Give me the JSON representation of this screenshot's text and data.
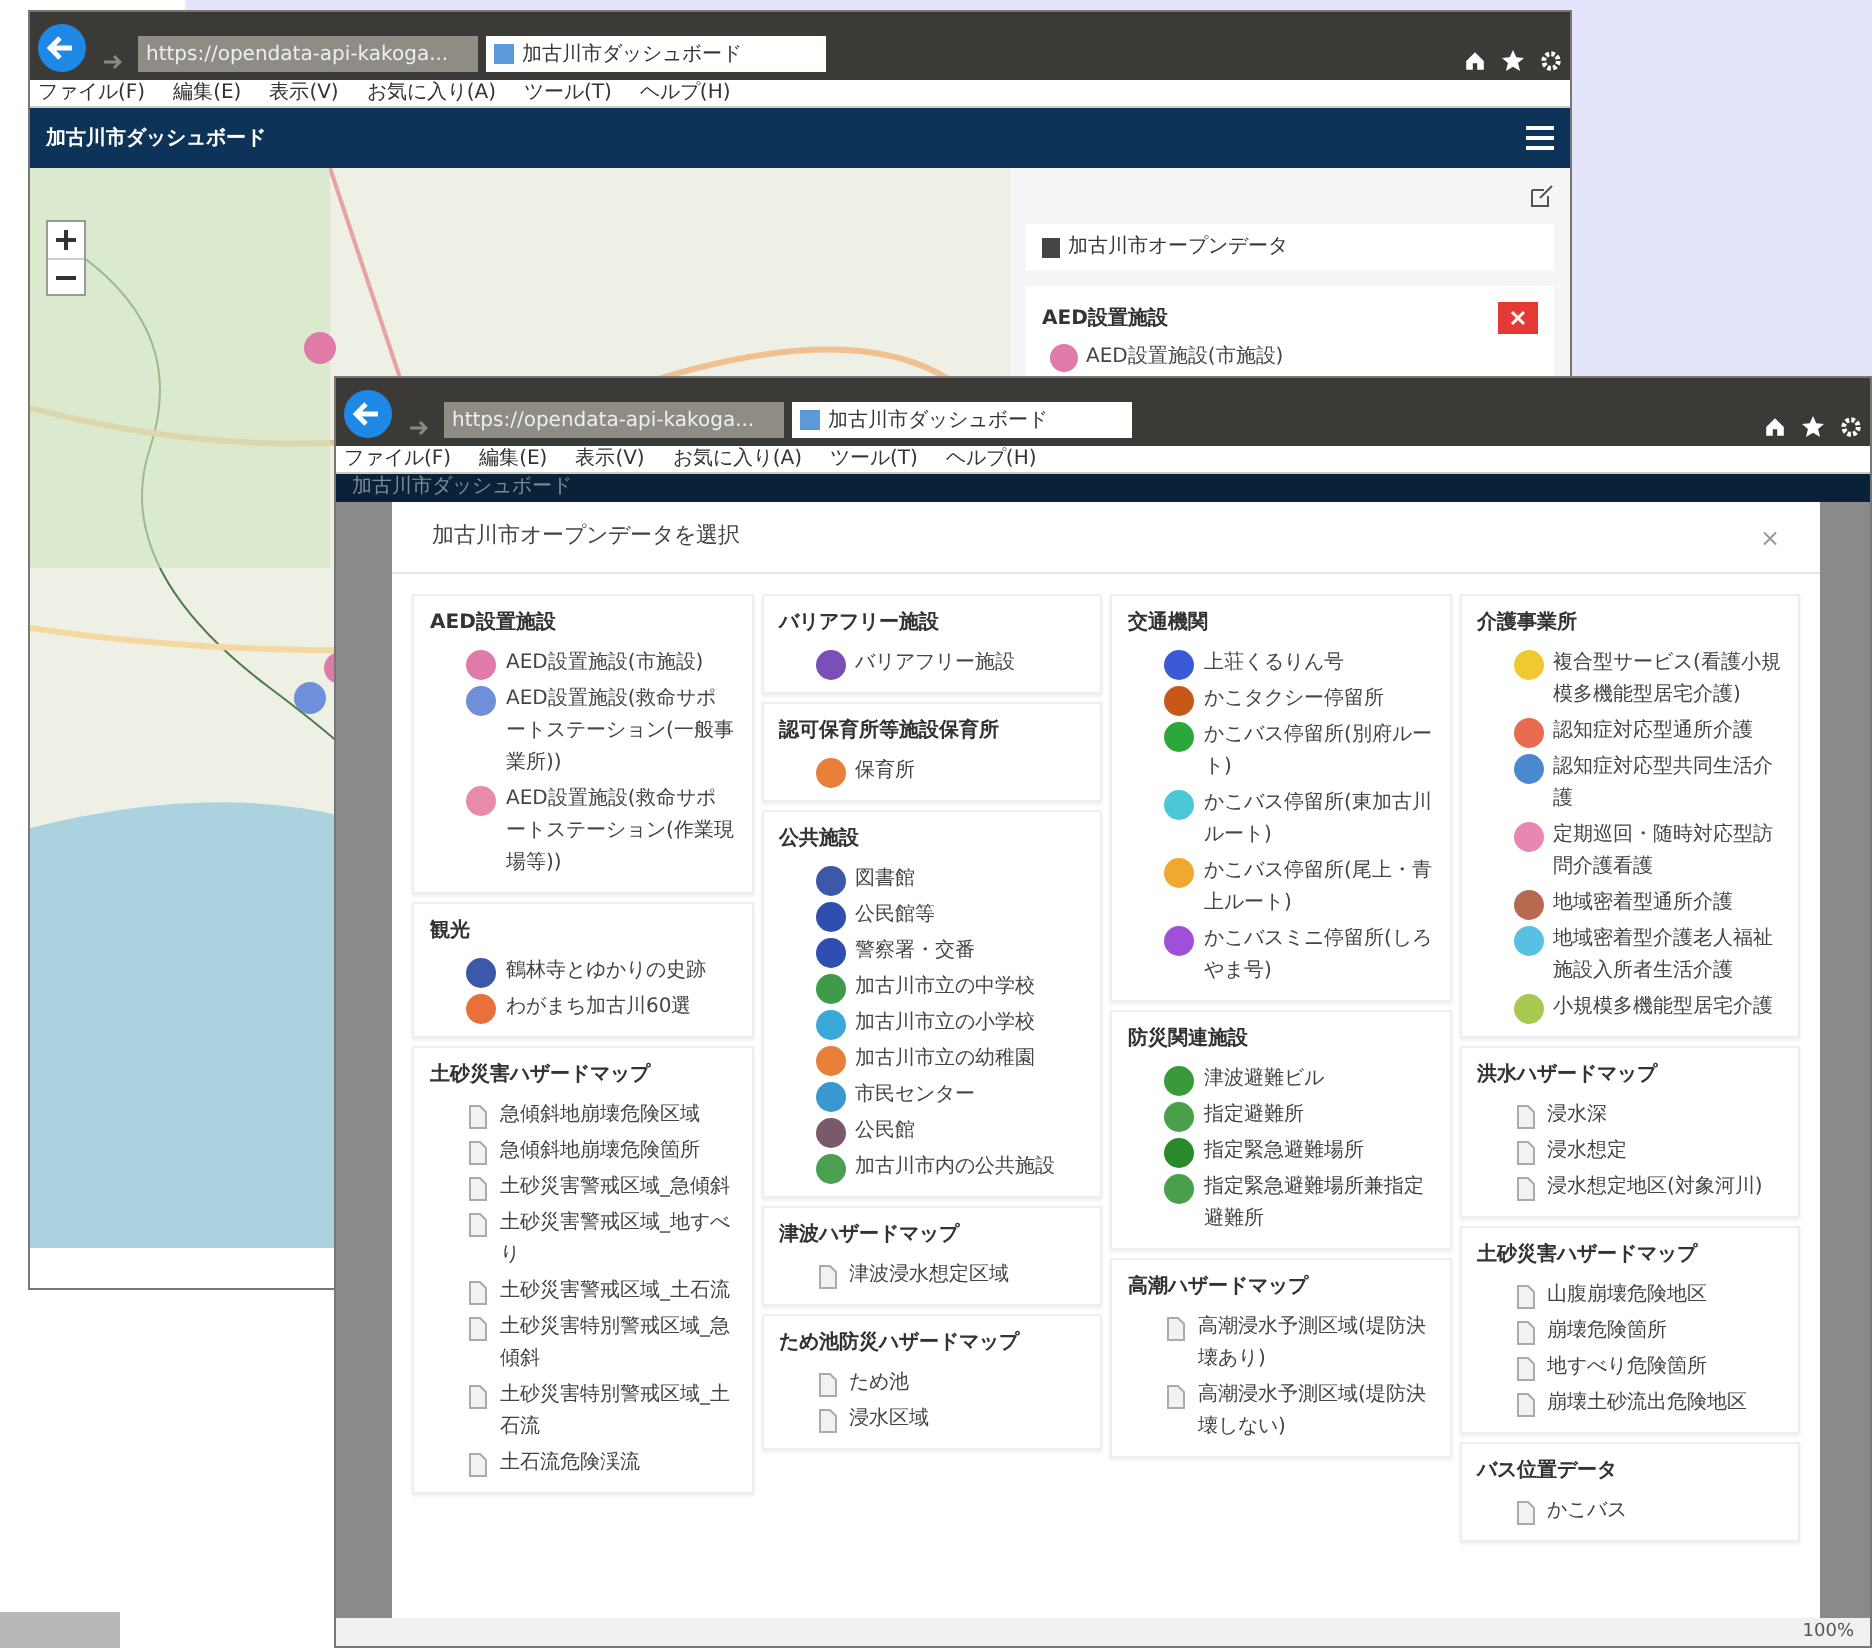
{
  "back_window": {
    "address": "https://opendata-api-kakoga...",
    "tab_title": "加古川市ダッシュボード",
    "menu": [
      "ファイル(F)",
      "編集(E)",
      "表示(V)",
      "お気に入り(A)",
      "ツール(T)",
      "ヘルプ(H)"
    ],
    "app_title": "加古川市ダッシュボード",
    "panel_title": "加古川市オープンデータ",
    "card_title": "AED設置施設",
    "card_items": [
      {
        "label": "AED設置施設(市施設)",
        "color": "#e07aa8"
      }
    ]
  },
  "front_window": {
    "address": "https://opendata-api-kakoga...",
    "tab_title": "加古川市ダッシュボード",
    "menu": [
      "ファイル(F)",
      "編集(E)",
      "表示(V)",
      "お気に入り(A)",
      "ツール(T)",
      "ヘルプ(H)"
    ],
    "app_title": "加古川市ダッシュボード",
    "zoom": "100%",
    "modal": {
      "title": "加古川市オープンデータを選択",
      "close": "×",
      "columns": [
        {
          "sections": [
            {
              "title": "AED設置施設",
              "items": [
                {
                  "kind": "point",
                  "label": "AED設置施設(市施設)",
                  "color": "#e07aa8"
                },
                {
                  "kind": "point",
                  "label": "AED設置施設(救命サポートステーション(一般事業所))",
                  "color": "#6f8fd8"
                },
                {
                  "kind": "point",
                  "label": "AED設置施設(救命サポートステーション(作業現場等))",
                  "color": "#e88aa8"
                }
              ]
            },
            {
              "title": "観光",
              "items": [
                {
                  "kind": "point",
                  "label": "鶴林寺とゆかりの史跡",
                  "color": "#3c58a8"
                },
                {
                  "kind": "point",
                  "label": "わがまち加古川60選",
                  "color": "#e8703a"
                }
              ]
            },
            {
              "title": "土砂災害ハザードマップ",
              "items": [
                {
                  "kind": "layer",
                  "label": "急傾斜地崩壊危険区域"
                },
                {
                  "kind": "layer",
                  "label": "急傾斜地崩壊危険箇所"
                },
                {
                  "kind": "layer",
                  "label": "土砂災害警戒区域_急傾斜"
                },
                {
                  "kind": "layer",
                  "label": "土砂災害警戒区域_地すべり"
                },
                {
                  "kind": "layer",
                  "label": "土砂災害警戒区域_土石流"
                },
                {
                  "kind": "layer",
                  "label": "土砂災害特別警戒区域_急傾斜"
                },
                {
                  "kind": "layer",
                  "label": "土砂災害特別警戒区域_土石流"
                },
                {
                  "kind": "layer",
                  "label": "土石流危険渓流"
                }
              ]
            }
          ]
        },
        {
          "sections": [
            {
              "title": "バリアフリー施設",
              "items": [
                {
                  "kind": "point",
                  "label": "バリアフリー施設",
                  "color": "#7a4fb8"
                }
              ]
            },
            {
              "title": "認可保育所等施設保育所",
              "items": [
                {
                  "kind": "point",
                  "label": "保育所",
                  "color": "#e8803a"
                }
              ]
            },
            {
              "title": "公共施設",
              "items": [
                {
                  "kind": "point",
                  "label": "図書館",
                  "color": "#3c58a8"
                },
                {
                  "kind": "point",
                  "label": "公民館等",
                  "color": "#2f4fb0"
                },
                {
                  "kind": "point",
                  "label": "警察署・交番",
                  "color": "#2f4fb0"
                },
                {
                  "kind": "point",
                  "label": "加古川市立の中学校",
                  "color": "#3f9a4a"
                },
                {
                  "kind": "point",
                  "label": "加古川市立の小学校",
                  "color": "#3aa8d8"
                },
                {
                  "kind": "point",
                  "label": "加古川市立の幼稚園",
                  "color": "#e8803a"
                },
                {
                  "kind": "point",
                  "label": "市民センター",
                  "color": "#3a98d0"
                },
                {
                  "kind": "point",
                  "label": "公民館",
                  "color": "#7a5a6a"
                },
                {
                  "kind": "point",
                  "label": "加古川市内の公共施設",
                  "color": "#4aa050"
                }
              ]
            },
            {
              "title": "津波ハザードマップ",
              "items": [
                {
                  "kind": "layer",
                  "label": "津波浸水想定区域"
                }
              ]
            },
            {
              "title": "ため池防災ハザードマップ",
              "items": [
                {
                  "kind": "layer",
                  "label": "ため池"
                },
                {
                  "kind": "layer",
                  "label": "浸水区域"
                }
              ]
            }
          ]
        },
        {
          "sections": [
            {
              "title": "交通機関",
              "items": [
                {
                  "kind": "point",
                  "label": "上荘くるりん号",
                  "color": "#3a5ad8"
                },
                {
                  "kind": "point",
                  "label": "かこタクシー停留所",
                  "color": "#c8581a"
                },
                {
                  "kind": "point",
                  "label": "かこバス停留所(別府ルート)",
                  "color": "#2aa83a"
                },
                {
                  "kind": "point",
                  "label": "かこバス停留所(東加古川ルート)",
                  "color": "#4ac8d8"
                },
                {
                  "kind": "point",
                  "label": "かこバス停留所(尾上・青上ルート)",
                  "color": "#f0a830"
                },
                {
                  "kind": "point",
                  "label": "かこバスミニ停留所(しろやま号)",
                  "color": "#a050d8"
                }
              ]
            },
            {
              "title": "防災関連施設",
              "items": [
                {
                  "kind": "point",
                  "label": "津波避難ビル",
                  "color": "#3a9a3a"
                },
                {
                  "kind": "point",
                  "label": "指定避難所",
                  "color": "#4aa04a"
                },
                {
                  "kind": "point",
                  "label": "指定緊急避難場所",
                  "color": "#2a8a2a"
                },
                {
                  "kind": "point",
                  "label": "指定緊急避難場所兼指定避難所",
                  "color": "#4aa04a"
                }
              ]
            },
            {
              "title": "高潮ハザードマップ",
              "items": [
                {
                  "kind": "layer",
                  "label": "高潮浸水予測区域(堤防決壊あり)"
                },
                {
                  "kind": "layer",
                  "label": "高潮浸水予測区域(堤防決壊しない)"
                }
              ]
            }
          ]
        },
        {
          "sections": [
            {
              "title": "介護事業所",
              "items": [
                {
                  "kind": "point",
                  "label": "複合型サービス(看護小規模多機能型居宅介護)",
                  "color": "#f0c830"
                },
                {
                  "kind": "point",
                  "label": "認知症対応型通所介護",
                  "color": "#e86a50"
                },
                {
                  "kind": "point",
                  "label": "認知症対応型共同生活介護",
                  "color": "#4a88d0"
                },
                {
                  "kind": "point",
                  "label": "定期巡回・随時対応型訪問介護看護",
                  "color": "#e888b0"
                },
                {
                  "kind": "point",
                  "label": "地域密着型通所介護",
                  "color": "#b86a50"
                },
                {
                  "kind": "point",
                  "label": "地域密着型介護老人福祉施設入所者生活介護",
                  "color": "#58c0e0"
                },
                {
                  "kind": "point",
                  "label": "小規模多機能型居宅介護",
                  "color": "#a8c850"
                }
              ]
            },
            {
              "title": "洪水ハザードマップ",
              "items": [
                {
                  "kind": "layer",
                  "label": "浸水深"
                },
                {
                  "kind": "layer",
                  "label": "浸水想定"
                },
                {
                  "kind": "layer",
                  "label": "浸水想定地区(対象河川)"
                }
              ]
            },
            {
              "title": "土砂災害ハザードマップ",
              "items": [
                {
                  "kind": "layer",
                  "label": "山腹崩壊危険地区"
                },
                {
                  "kind": "layer",
                  "label": "崩壊危険箇所"
                },
                {
                  "kind": "layer",
                  "label": "地すべり危険箇所"
                },
                {
                  "kind": "layer",
                  "label": "崩壊土砂流出危険地区"
                }
              ]
            },
            {
              "title": "バス位置データ",
              "items": [
                {
                  "kind": "layer",
                  "label": "かこバス"
                }
              ]
            }
          ]
        }
      ]
    }
  }
}
